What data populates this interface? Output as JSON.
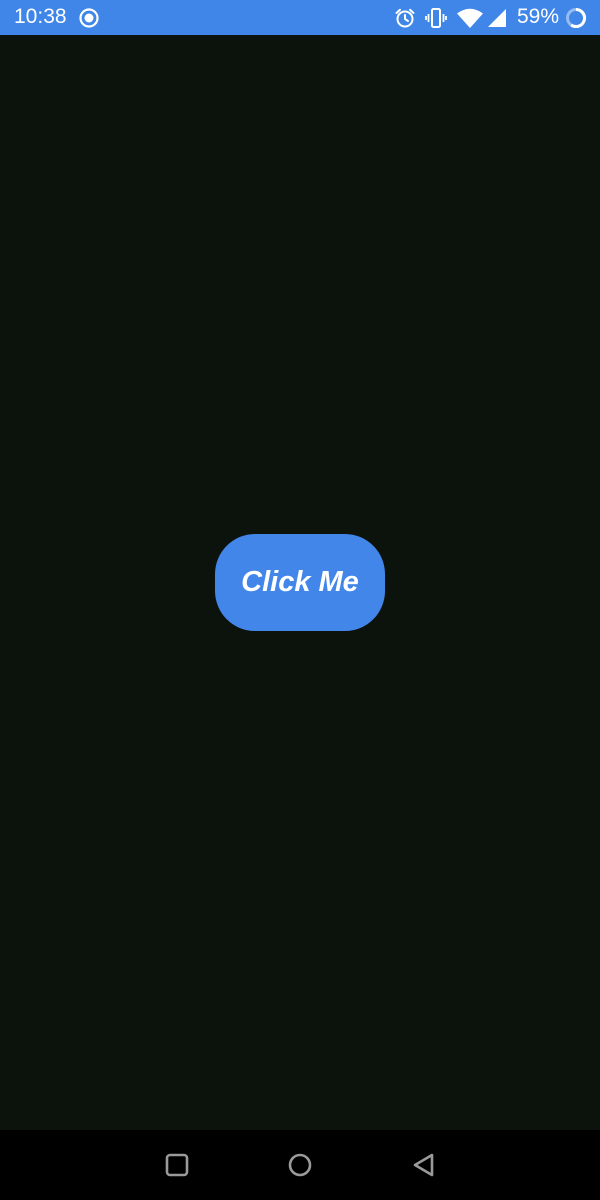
{
  "status_bar": {
    "time": "10:38",
    "battery_percent": "59%",
    "icons": [
      "record-icon",
      "alarm-icon",
      "vibrate-icon",
      "wifi-icon",
      "cell-signal-icon",
      "battery-icon"
    ],
    "background_color": "#3f86e8"
  },
  "main": {
    "button_label": "Click Me",
    "button_color": "#4286e9",
    "background_color": "#0c120c"
  },
  "nav_bar": {
    "buttons": [
      "recents-button",
      "home-button",
      "back-button"
    ]
  }
}
